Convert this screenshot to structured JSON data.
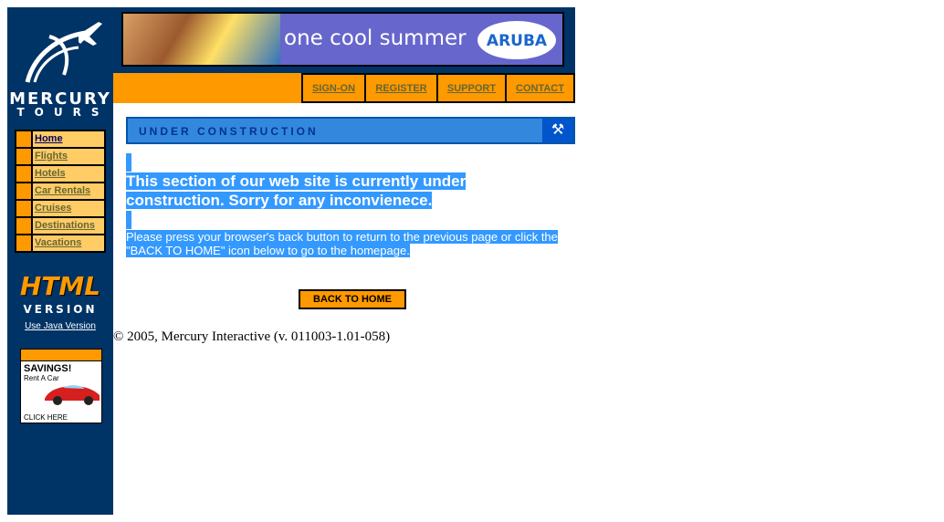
{
  "logo": {
    "line1": "MERCURY",
    "line2": "TOURS"
  },
  "nav": [
    {
      "label": "Home",
      "active": true
    },
    {
      "label": "Flights",
      "active": false
    },
    {
      "label": "Hotels",
      "active": false
    },
    {
      "label": "Car Rentals",
      "active": false
    },
    {
      "label": "Cruises",
      "active": false
    },
    {
      "label": "Destinations",
      "active": false
    },
    {
      "label": "Vacations",
      "active": false
    }
  ],
  "html_version": {
    "title": "HTML",
    "subtitle": "VERSION",
    "java_link": "Use Java Version"
  },
  "ad": {
    "headline": "SAVINGS!",
    "sub": "Rent A Car",
    "cta": "CLICK HERE"
  },
  "banner": {
    "slogan": "one cool summer",
    "brand": "ARUBA"
  },
  "top_links": [
    "SIGN-ON",
    "REGISTER",
    "SUPPORT",
    "CONTACT"
  ],
  "section_title": "UNDER CONSTRUCTION",
  "message": {
    "main": "This section of our web site is currently under construction.  Sorry for any inconvienece.",
    "sub": "Please press your browser's back button to return to the previous page or click the \"BACK TO HOME\" icon below to go to the homepage."
  },
  "back_button": "BACK TO HOME",
  "copyright": "© 2005, Mercury Interactive (v. 011003-1.01-058)",
  "colors": {
    "navy": "#003366",
    "orange": "#FF9900",
    "nav_bg": "#FFCC66",
    "selection": "#3399FF",
    "header_blue": "#3388DD"
  }
}
